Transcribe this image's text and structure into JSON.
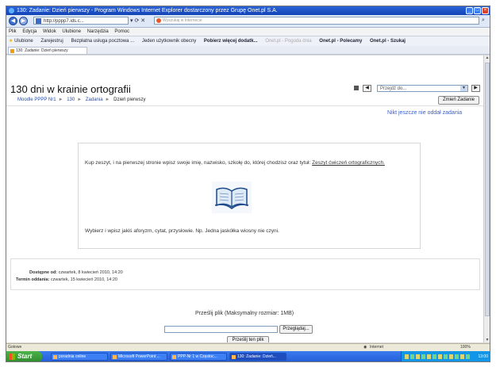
{
  "window": {
    "title": "130: Zadanie: Dzień pierwszy - Program Windows Internet Explorer dostarczony przez Grupę Onet.pl S.A."
  },
  "addressbar": {
    "url": "http://pppp7.ids.c...",
    "search_placeholder": "Wyszukaj w Internecie"
  },
  "menu": [
    "Plik",
    "Edycja",
    "Widok",
    "Ulubione",
    "Narzędzia",
    "Pomoc"
  ],
  "favorites": {
    "label": "Ulubione",
    "items": [
      "Zarejestruj",
      "Bezpłatna usługa pocztowa ...",
      "Jeden użytkownik obecny",
      "Pobierz więcej dodatk...",
      "Onet.pl - Pogoda dnia",
      "Onet.pl - Polecamy",
      "Onet.pl - Szukaj"
    ]
  },
  "tab": {
    "label": "130: Zadanie: Dzień pierwszy"
  },
  "page": {
    "site_title": "130 dni w krainie ortografii",
    "jump_placeholder": "Przejdź do...",
    "breadcrumb": [
      "Moodle PPPP Nr1",
      "130",
      "Zadania",
      "Dzień pierwszy"
    ],
    "edit_button": "Zmień Zadanie",
    "no_submissions": "Nikt jeszcze nie oddał zadania",
    "task_text_1": "Kup zeszyt, i na pierwszej stronie wpisz swoje imię, nazwisko, szkołę do, której chodzisz oraz tytuł:",
    "task_link": "Zeszyt ćwiczeń ortograficznych.",
    "task_text_2": "Wybierz i wpisz jakiś aforyzm, cytat, przysłowie. Np. Jedna jaskółka wiosny nie czyni.",
    "available_label": "Dostępne od:",
    "available_value": "czwartek, 8 kwiecień 2010, 14:20",
    "due_label": "Termin oddania:",
    "due_value": "czwartek, 15 kwiecień 2010, 14:20",
    "upload_label": "Prześlij plik (Maksymalny rozmiar: 1MB)",
    "browse_button": "Przeglądaj...",
    "send_button": "Prześlij ten plik"
  },
  "statusbar": {
    "left": "Gotowe",
    "zone": "Internet",
    "zoom": "100%"
  },
  "taskbar": {
    "start": "Start",
    "items": [
      "poradnia online",
      "Microsoft PowerPoint ...",
      "PPP-Nr 1 w Częstoc...",
      "130: Zadanie: Dzień..."
    ],
    "clock": "13:00"
  }
}
